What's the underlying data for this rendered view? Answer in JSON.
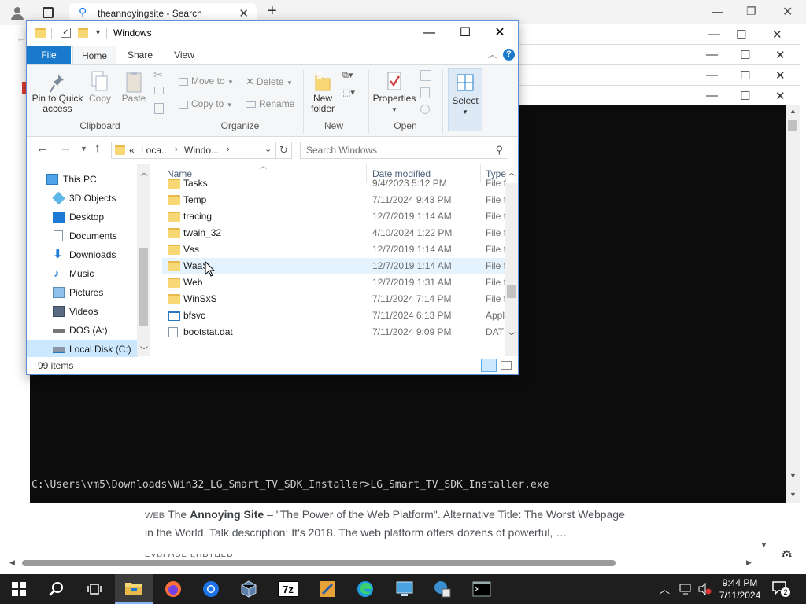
{
  "browser": {
    "tab_title": "theannoyingsite - Search",
    "result_tag": "WEB",
    "result_bold": "Annoying Site",
    "result_pre": "The ",
    "result_post": " – \"The Power of the Web Platform\". Alternative Title: The Worst Webpage in the World. Talk description: It's 2018. The web platform offers dozens of powerful, …",
    "explore_label": "EXPLORE FURTHER"
  },
  "console": {
    "line": "C:\\Users\\vm5\\Downloads\\Win32_LG_Smart_TV_SDK_Installer>LG_Smart_TV_SDK_Installer.exe"
  },
  "explorer": {
    "title": "Windows",
    "tabs": [
      "File",
      "Home",
      "Share",
      "View"
    ],
    "ribbon": {
      "pin_label": "Pin to Quick access",
      "copy_label": "Copy",
      "paste_label": "Paste",
      "clipboard_group": "Clipboard",
      "move_to_label": "Move to",
      "copy_to_label": "Copy to",
      "delete_label": "Delete",
      "rename_label": "Rename",
      "organize_group": "Organize",
      "new_folder_label": "New folder",
      "new_group": "New",
      "properties_label": "Properties",
      "open_group": "Open",
      "select_label": "Select"
    },
    "address": {
      "crumbs": [
        "«",
        "Loca...",
        "Windo..."
      ],
      "search_placeholder": "Search Windows"
    },
    "nav_items": [
      {
        "label": "This PC",
        "icon": "this-pc-icon"
      },
      {
        "label": "3D Objects",
        "icon": "3d-objects-icon"
      },
      {
        "label": "Desktop",
        "icon": "desktop-icon"
      },
      {
        "label": "Documents",
        "icon": "documents-icon"
      },
      {
        "label": "Downloads",
        "icon": "downloads-icon"
      },
      {
        "label": "Music",
        "icon": "music-icon"
      },
      {
        "label": "Pictures",
        "icon": "pictures-icon"
      },
      {
        "label": "Videos",
        "icon": "videos-icon"
      },
      {
        "label": "DOS (A:)",
        "icon": "floppy-drive-icon"
      },
      {
        "label": "Local Disk (C:)",
        "icon": "local-disk-icon"
      }
    ],
    "columns": {
      "name": "Name",
      "date": "Date modified",
      "type": "Type"
    },
    "files": [
      {
        "name": "Tasks",
        "date": "9/4/2023 5:12 PM",
        "type": "File f",
        "kind": "folder"
      },
      {
        "name": "Temp",
        "date": "7/11/2024 9:43 PM",
        "type": "File f",
        "kind": "folder"
      },
      {
        "name": "tracing",
        "date": "12/7/2019 1:14 AM",
        "type": "File f",
        "kind": "folder"
      },
      {
        "name": "twain_32",
        "date": "4/10/2024 1:22 PM",
        "type": "File f",
        "kind": "folder"
      },
      {
        "name": "Vss",
        "date": "12/7/2019 1:14 AM",
        "type": "File f",
        "kind": "folder"
      },
      {
        "name": "WaaS",
        "date": "12/7/2019 1:14 AM",
        "type": "File f",
        "kind": "folder"
      },
      {
        "name": "Web",
        "date": "12/7/2019 1:31 AM",
        "type": "File f",
        "kind": "folder"
      },
      {
        "name": "WinSxS",
        "date": "7/11/2024 7:14 PM",
        "type": "File f",
        "kind": "folder"
      },
      {
        "name": "bfsvc",
        "date": "7/11/2024 6:13 PM",
        "type": "Appl",
        "kind": "app"
      },
      {
        "name": "bootstat.dat",
        "date": "7/11/2024 9:09 PM",
        "type": "DAT",
        "kind": "file"
      }
    ],
    "status": "99 items"
  },
  "taskbar": {
    "time": "9:44 PM",
    "date": "7/11/2024",
    "notification_count": "2",
    "zip_label": "7z"
  },
  "colors": {
    "accent": "#1979ca",
    "selection": "#cce8ff",
    "folder": "#f8d775",
    "console_bg": "#0c0c0c",
    "taskbar_bg": "#1e1e1e"
  }
}
